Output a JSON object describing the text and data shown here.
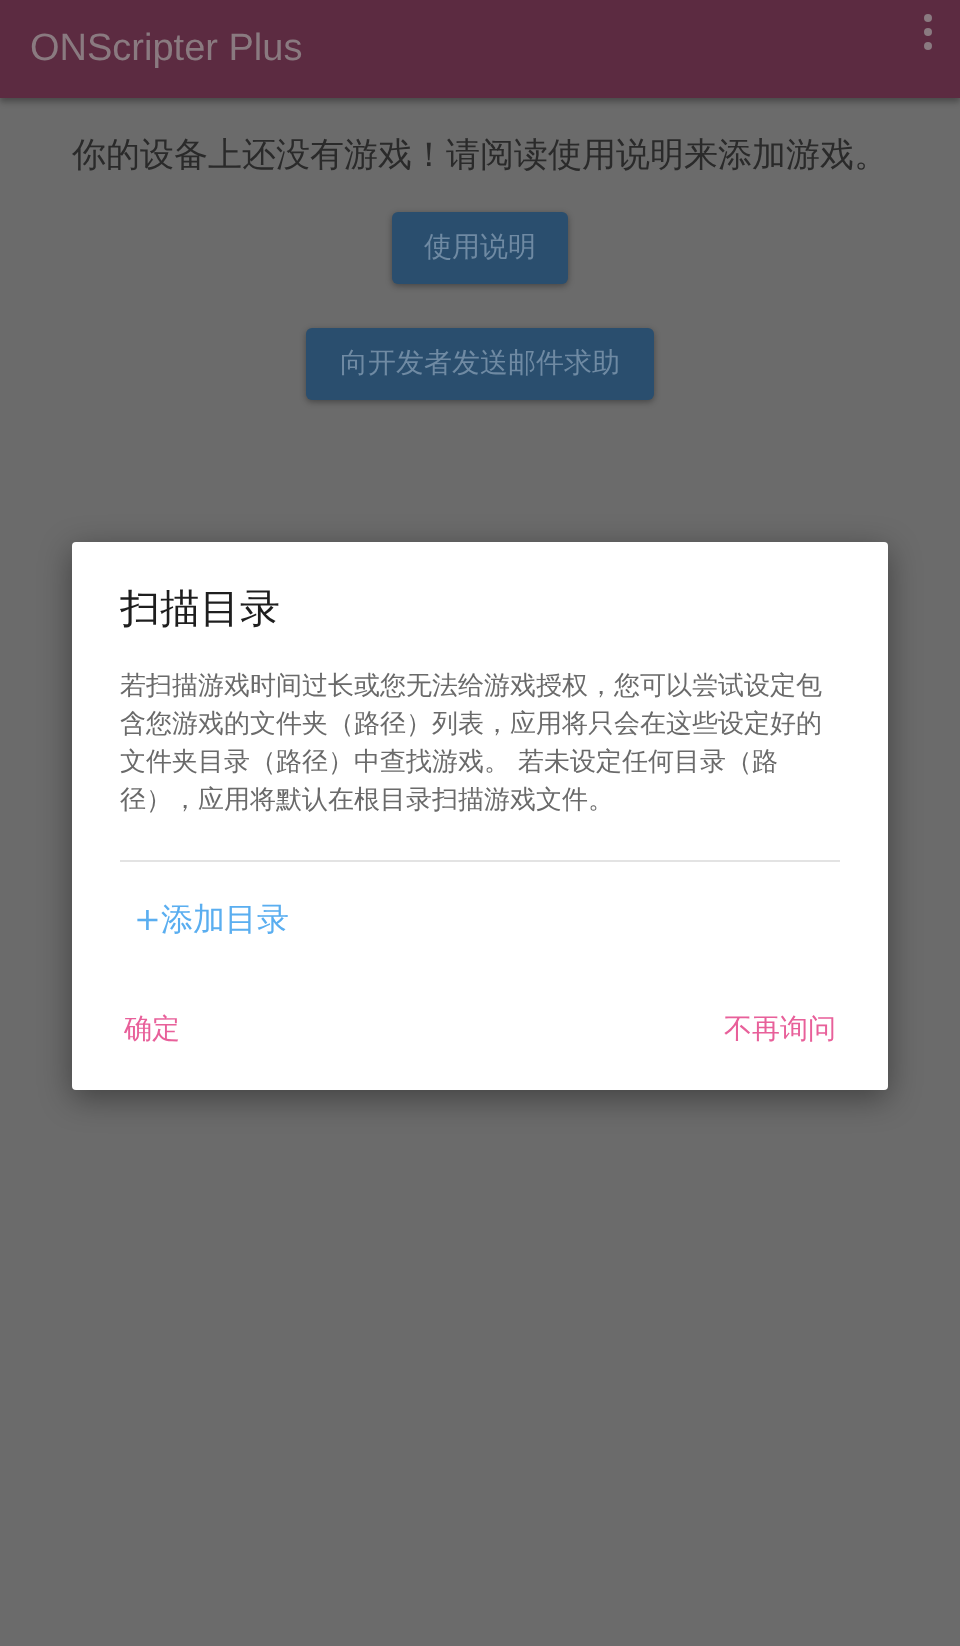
{
  "app_bar": {
    "title": "ONScripter Plus"
  },
  "content": {
    "message": "你的设备上还没有游戏！请阅读使用说明来添加游戏。",
    "buttons": [
      "使用说明",
      "向开发者发送邮件求助"
    ]
  },
  "dialog": {
    "title": "扫描目录",
    "body": "若扫描游戏时间过长或您无法给游戏授权，您可以尝试设定包含您游戏的文件夹（路径）列表，应用将只会在这些设定好的文件夹目录（路径）中查找游戏。 若未设定任何目录（路径），应用将默认在根目录扫描游戏文件。",
    "add_link": "+添加目录",
    "actions": [
      "确定",
      "不再询问"
    ]
  }
}
